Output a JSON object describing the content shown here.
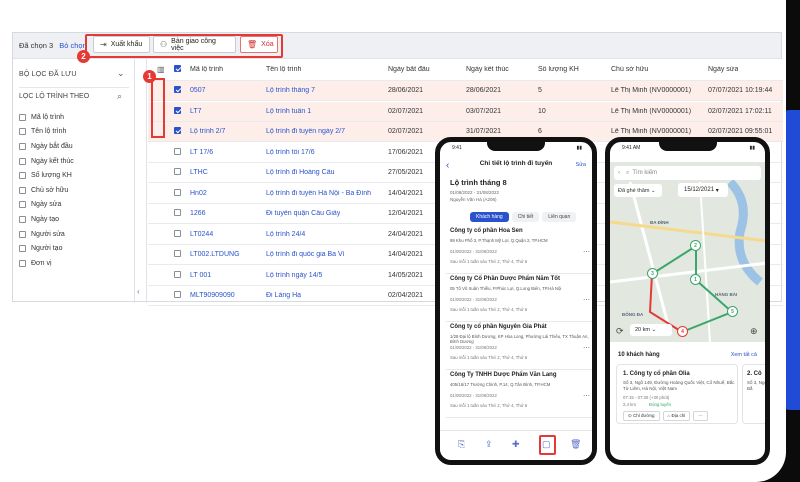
{
  "colors": {
    "accent": "#2952cc",
    "highlight_row": "#fdeeea",
    "annotation": "#e53935",
    "pin_green": "#3aa66b"
  },
  "toolbar": {
    "selected_count": "Đã chọn 3",
    "deselect": "Bỏ chọn",
    "export": "Xuất khẩu",
    "handover": "Bàn giao công việc",
    "delete": "Xóa"
  },
  "badges": {
    "one": "1",
    "two": "2"
  },
  "filter": {
    "saved": "BỘ LỌC ĐÃ LƯU",
    "by_route": "LỌC LỘ TRÌNH THEO",
    "items": [
      "Mã lộ trình",
      "Tên lộ trình",
      "Ngày bắt đầu",
      "Ngày kết thúc",
      "Số lượng KH",
      "Chủ sở hữu",
      "Ngày sửa",
      "Ngày tạo",
      "Người sửa",
      "Người tạo",
      "Đơn vị"
    ]
  },
  "table": {
    "headers": [
      "Mã lộ trình",
      "Tên lộ trình",
      "Ngày bắt đầu",
      "Ngày kết thúc",
      "Số lượng KH",
      "Chủ sở hữu",
      "Ngày sửa"
    ],
    "rows": [
      {
        "ma": "0507",
        "ten": "Lộ trình tháng 7",
        "bd": "28/06/2021",
        "kt": "28/06/2021",
        "sl": "5",
        "cs": "Lê Thị Minh (NV0000001)",
        "ns": "07/07/2021 10:19:44",
        "checked": true
      },
      {
        "ma": "LT7",
        "ten": "Lộ trình tuần 1",
        "bd": "02/07/2021",
        "kt": "03/07/2021",
        "sl": "10",
        "cs": "Lê Thị Minh (NV0000001)",
        "ns": "02/07/2021 17:02:11",
        "checked": true
      },
      {
        "ma": "Lộ trình 2/7",
        "ten": "Lộ trình đi tuyến ngày 2/7",
        "bd": "02/07/2021",
        "kt": "31/07/2021",
        "sl": "6",
        "cs": "Lê Thị Minh (NV0000001)",
        "ns": "02/07/2021 09:55:01",
        "checked": true
      },
      {
        "ma": "LT 17/6",
        "ten": "Lộ trình tối 17/6",
        "bd": "17/06/2021",
        "kt": "",
        "sl": "",
        "cs": "",
        "ns": "",
        "checked": false
      },
      {
        "ma": "LTHC",
        "ten": "Lộ trình đi Hoàng Cầu",
        "bd": "27/05/2021",
        "kt": "",
        "sl": "",
        "cs": "",
        "ns": "",
        "checked": false
      },
      {
        "ma": "Hn02",
        "ten": "Lộ trình đi tuyến Hà Nội - Ba Đình",
        "bd": "14/04/2021",
        "kt": "",
        "sl": "",
        "cs": "",
        "ns": "",
        "checked": false
      },
      {
        "ma": "1266",
        "ten": "Đi tuyến quận Cầu Giấy",
        "bd": "12/04/2021",
        "kt": "",
        "sl": "",
        "cs": "",
        "ns": "",
        "checked": false
      },
      {
        "ma": "LT0244",
        "ten": "Lộ trình 24/4",
        "bd": "24/04/2021",
        "kt": "",
        "sl": "",
        "cs": "",
        "ns": "",
        "checked": false
      },
      {
        "ma": "LT002.LTDUNG",
        "ten": "Lộ trình đi quốc gia Ba Vì",
        "bd": "14/04/2021",
        "kt": "",
        "sl": "",
        "cs": "",
        "ns": "",
        "checked": false
      },
      {
        "ma": "LT 001",
        "ten": "Lộ trình ngày 14/5",
        "bd": "14/05/2021",
        "kt": "",
        "sl": "",
        "cs": "",
        "ns": "",
        "checked": false
      },
      {
        "ma": "MLT90909090",
        "ten": "Đi Láng Hạ",
        "bd": "02/04/2021",
        "kt": "",
        "sl": "",
        "cs": "",
        "ns": "",
        "checked": false
      }
    ]
  },
  "phone1": {
    "time": "9:41",
    "header": "Chi tiết lộ trình đi tuyến",
    "edit": "Sửa",
    "title": "Lộ trình tháng 8",
    "dates": "01/08/2022 - 31/08/2022",
    "owner": "Nguyễn Văn Hà (A206)",
    "tabs": [
      "Khách hàng",
      "Chi tiết",
      "Liên quan"
    ],
    "customers": [
      {
        "name": "Công ty cổ phần Hoa Sen",
        "addr": "99 Khu Phố 3, P.Thạnh Mỹ Lợi, Q.Quận 2, TP.HCM",
        "dates": "01/08/2022 - 31/08/2022",
        "freq": "Sau mỗi 1 tuần vào Thứ 2, Thứ 4, Thứ 6"
      },
      {
        "name": "Công ty Cổ Phần Dược Phẩm Năm Tốt",
        "addr": "05 Tô Vũ Xuân Thiều, P.Phúc Lợi, Q.Long Biên, TP.Hà Nội",
        "dates": "01/08/2022 - 31/08/2022",
        "freq": "Sau mỗi 1 tuần vào Thứ 2, Thứ 4, Thứ 6"
      },
      {
        "name": "Công ty cổ phần Nguyên Gia Phát",
        "addr": "1/28 Đại lộ Bình Dương, KP Hòa Long, Phường Lái Thiêu, TX Thuận An, Bình Dương",
        "dates": "01/08/2022 - 31/08/2022",
        "freq": "Sau mỗi 1 tuần vào Thứ 2, Thứ 4, Thứ 6"
      },
      {
        "name": "Công Ty TNHH Dược Phẩm Văn Lang",
        "addr": "405/16/17 Trường Chinh, P.14, Q.Tân Bình, TP.HCM",
        "dates": "01/08/2022 - 31/08/2022",
        "freq": "Sau mỗi 1 tuần vào Thứ 2, Thứ 4, Thứ 6"
      }
    ]
  },
  "phone2": {
    "time": "9:41 AM",
    "search_placeholder": "Tìm kiếm",
    "chip": "Đã ghé thăm",
    "date": "15/12/2021",
    "zoom": "20 km",
    "map_labels": [
      "BA ĐÌNH",
      "HÀNG BÀI",
      "ĐỐNG ĐA"
    ],
    "pins": [
      "2",
      "3",
      "1",
      "4",
      "5"
    ],
    "list_count": "10 khách hàng",
    "view_all": "Xem tất cả",
    "card": {
      "name": "1. Công ty cổ phần Olia",
      "addr": "Số 3, Ngõ 149, Đường Hoàng Quốc Việt, Cổ Nhuế, Bắc Từ Liêm, Hà Nội, Việt Nam",
      "time": "07:15 - 07:30 (+30 phút)",
      "distance": "2,4 km",
      "status": "Đúng tuyến",
      "btn_route": "Chỉ đường",
      "btn_addr": "Địa chỉ"
    },
    "card2": {
      "name": "2. Cô",
      "addr": "Số 3, Ngõ Nhuế, Bắ"
    }
  }
}
